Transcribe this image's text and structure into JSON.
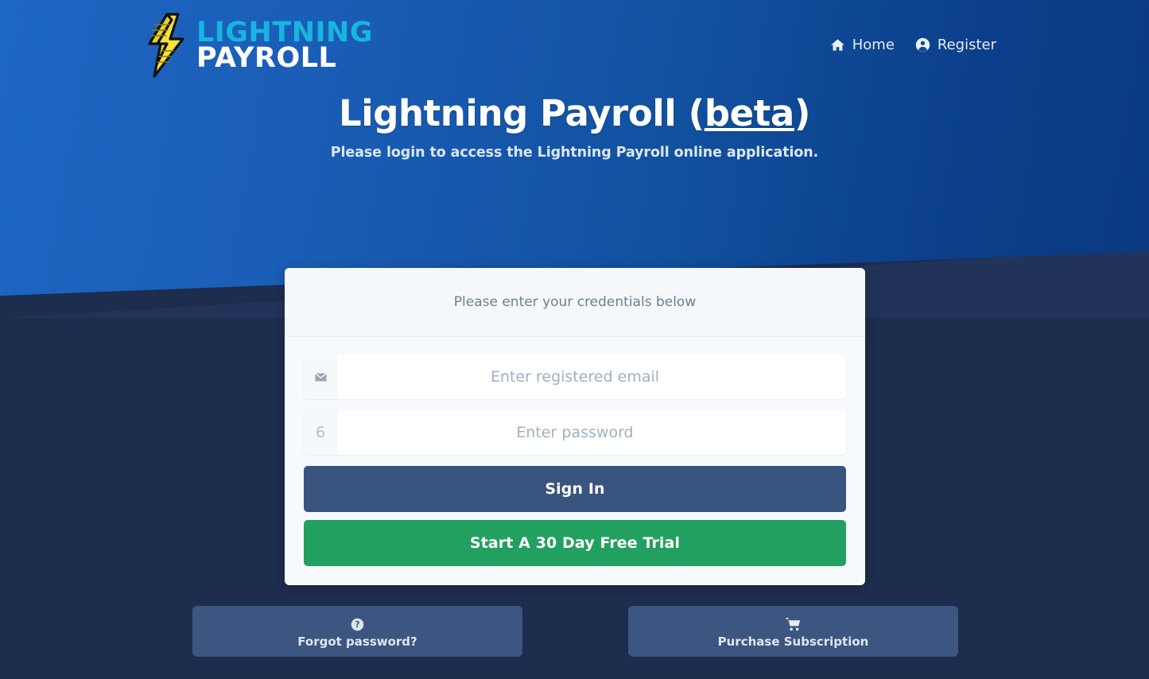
{
  "brand": {
    "logo_line1": "LIGHTNING",
    "logo_line2": "PAYROLL",
    "logo_icon": "lightning-bolt-icon",
    "colors": {
      "logo_cyan": "#17b5e0",
      "logo_white": "#ffffff",
      "bolt_yellow": "#f5dd31",
      "hero_blue_left": "#1d66c2",
      "hero_blue_right": "#093a80",
      "page_dark": "#1c2d4d",
      "signin_blue": "#3a5480",
      "trial_green": "#22a05f",
      "action_blue": "#3c5681"
    }
  },
  "nav": {
    "links": [
      {
        "label": "Home",
        "icon": "home-icon"
      },
      {
        "label": "Register",
        "icon": "user-circle-icon"
      }
    ]
  },
  "hero": {
    "title_main": "Lightning Payroll (",
    "title_beta": "beta",
    "title_close": ")",
    "subtitle": "Please login to access the Lightning Payroll online application."
  },
  "card": {
    "header_text": "Please enter your credentials below",
    "email_field": {
      "placeholder": "Enter registered email",
      "value": "",
      "icon": "envelope-icon"
    },
    "password_field": {
      "placeholder": "Enter password",
      "value": "",
      "icon": "unlock-icon",
      "icon_glyph": "6"
    },
    "signin_label": "Sign In",
    "trial_label": "Start A 30 Day Free Trial"
  },
  "bottom_actions": [
    {
      "label": "Forgot password?",
      "icon": "question-circle-icon"
    },
    {
      "label": "Purchase Subscription",
      "icon": "shopping-cart-icon"
    }
  ]
}
